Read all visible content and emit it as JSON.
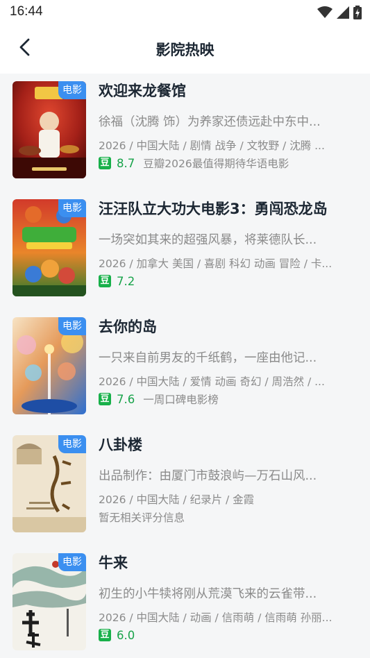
{
  "status_bar": {
    "time": "16:44",
    "icons": [
      "wifi-icon",
      "signal-icon",
      "battery-charging-icon"
    ]
  },
  "app_bar": {
    "title": "影院热映",
    "back_icon": "chevron-left-icon"
  },
  "colors": {
    "badge": "#3b8ff0",
    "douban_green": "#18b04a",
    "score_green": "#18a34a"
  },
  "movies": [
    {
      "badge": "电影",
      "title": "欢迎来龙餐馆",
      "synopsis": "徐福（沈腾 饰）为养家还债远赴中东中...",
      "meta": "2026 / 中国大陆 / 剧情 战争 / 文牧野 / 沈腾 ...",
      "douban_icon": "豆",
      "score": "8.7",
      "tag": "豆瓣2026最值得期待华语电影"
    },
    {
      "badge": "电影",
      "title": "汪汪队立大功大电影3：勇闯恐龙岛",
      "synopsis": "一场突如其来的超强风暴，将莱德队长...",
      "meta": "2026 / 加拿大 美国 / 喜剧 科幻 动画 冒险 / 卡...",
      "douban_icon": "豆",
      "score": "7.2",
      "tag": ""
    },
    {
      "badge": "电影",
      "title": "去你的岛",
      "synopsis": "一只来自前男友的千纸鹤，一座由他记...",
      "meta": "2026 / 中国大陆 / 爱情 动画 奇幻 / 周浩然 / ...",
      "douban_icon": "豆",
      "score": "7.6",
      "tag": "一周口碑电影榜"
    },
    {
      "badge": "电影",
      "title": "八卦楼",
      "synopsis": "出品制作：由厦门市鼓浪屿—万石山风...",
      "meta": "2026 / 中国大陆 / 纪录片 / 金霞",
      "no_rating": "暂无相关评分信息"
    },
    {
      "badge": "电影",
      "title": "牛来",
      "synopsis": "初生的小牛犊将刚从荒漠飞来的云雀带...",
      "meta": "2026 / 中国大陆 / 动画 / 信雨萌 / 信雨萌 孙丽...",
      "douban_icon": "豆",
      "score": "6.0",
      "tag": ""
    }
  ]
}
